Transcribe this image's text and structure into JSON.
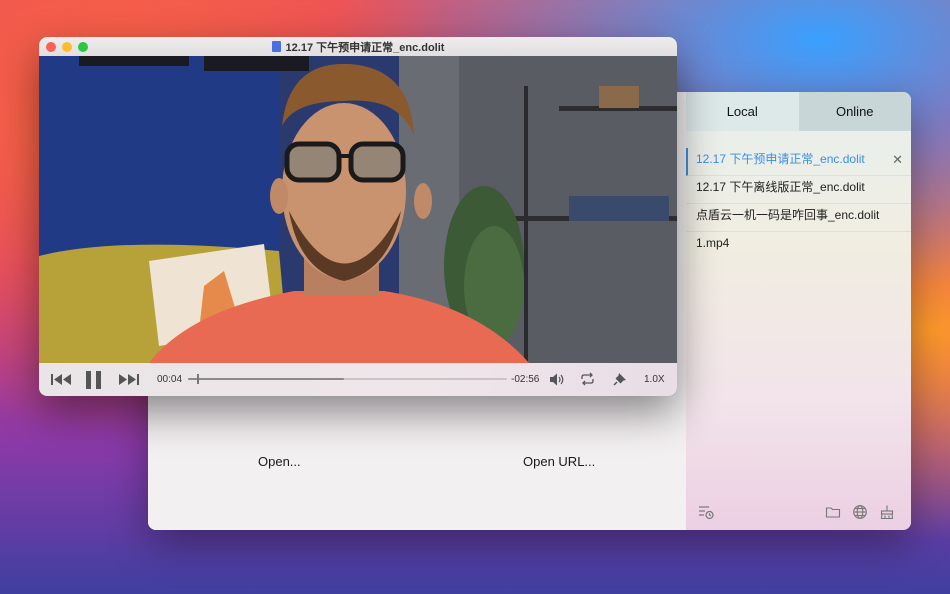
{
  "back_window": {
    "open_label": "Open...",
    "open_url_label": "Open URL..."
  },
  "sidebar": {
    "tabs": [
      {
        "label": "Local",
        "active": true
      },
      {
        "label": "Online",
        "active": false
      }
    ],
    "playlist": [
      {
        "name": "12.17 下午预申请正常_enc.dolit",
        "active": true
      },
      {
        "name": "12.17 下午离线版正常_enc.dolit",
        "active": false
      },
      {
        "name": "点盾云一机一码是咋回事_enc.dolit",
        "active": false
      },
      {
        "name": "1.mp4",
        "active": false
      }
    ],
    "close_glyph": "✕",
    "bottom_icons": [
      "playlist-history-icon",
      "folder-icon",
      "globe-icon",
      "clean-icon"
    ]
  },
  "player": {
    "title": "12.17 下午预申请正常_enc.dolit",
    "elapsed": "00:04",
    "remaining": "-02:56",
    "progress": 0.49,
    "speed": "1.0X",
    "colors": {
      "accent": "#3a8fe0",
      "close": "#fe5f57",
      "minimize": "#febc2e",
      "zoom": "#28c840"
    }
  }
}
